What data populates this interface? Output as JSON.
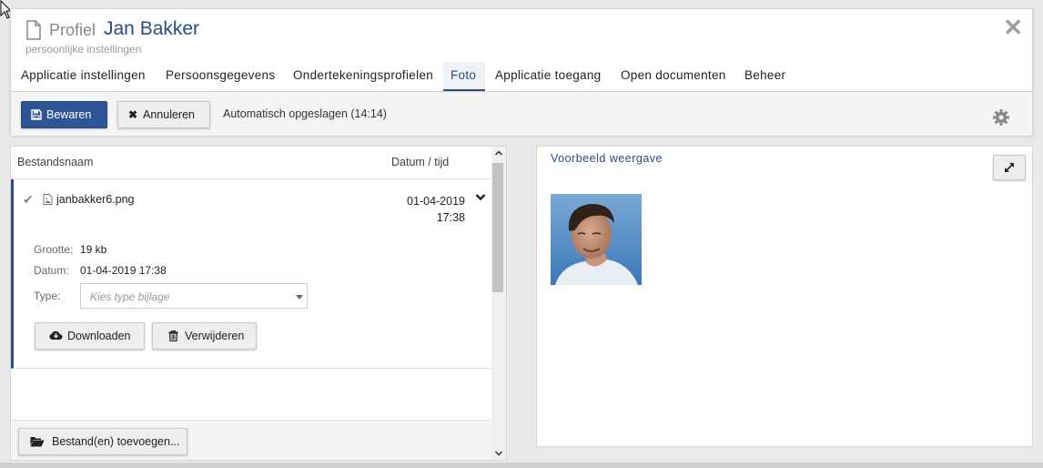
{
  "header": {
    "title_prefix": "Profiel",
    "title_name": "Jan Bakker",
    "subtitle": "persoonlijke instellingen"
  },
  "tabs": [
    {
      "label": "Applicatie instellingen",
      "active": false
    },
    {
      "label": "Persoonsgegevens",
      "active": false
    },
    {
      "label": "Ondertekeningsprofielen",
      "active": false
    },
    {
      "label": "Foto",
      "active": true
    },
    {
      "label": "Applicatie toegang",
      "active": false
    },
    {
      "label": "Open documenten",
      "active": false
    },
    {
      "label": "Beheer",
      "active": false
    }
  ],
  "toolbar": {
    "save_label": "Bewaren",
    "cancel_label": "Annuleren",
    "autosave_status": "Automatisch opgeslagen (14:14)"
  },
  "files": {
    "col_filename": "Bestandsnaam",
    "col_datetime": "Datum / tijd",
    "items": [
      {
        "name": "janbakker6.png",
        "date": "01-04-2019",
        "time": "17:38",
        "size_label": "Grootte:",
        "size": "19 kb",
        "date_label": "Datum:",
        "datetime": "01-04-2019 17:38",
        "type_label": "Type:",
        "type_placeholder": "Kies type bijlage",
        "download_label": "Downloaden",
        "delete_label": "Verwijderen"
      }
    ],
    "add_label": "Bestand(en) toevoegen..."
  },
  "preview": {
    "title": "Voorbeeld weergave"
  },
  "colors": {
    "accent": "#2b4a86",
    "primary_button": "#2f5596"
  }
}
